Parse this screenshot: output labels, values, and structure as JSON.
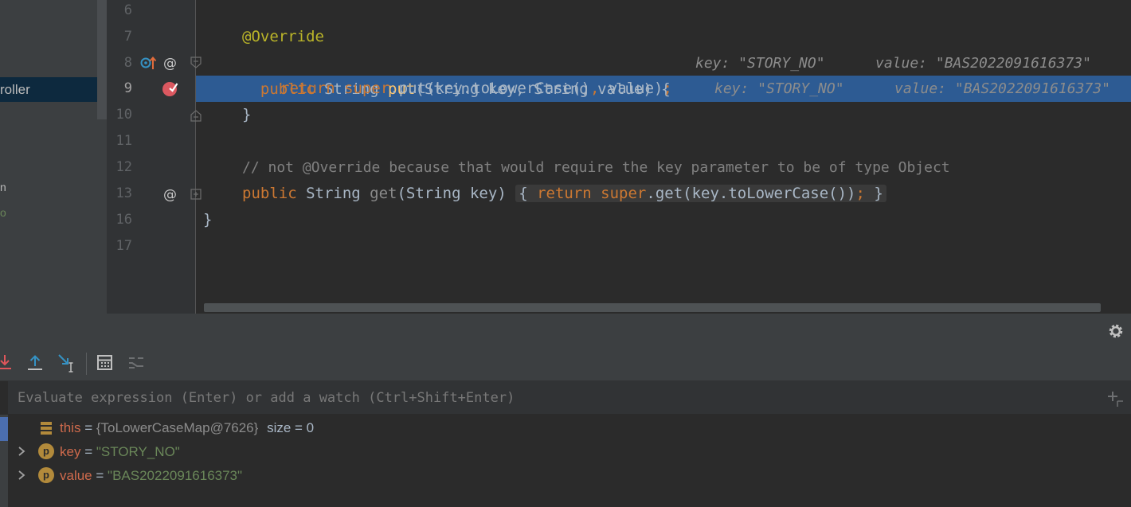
{
  "sidebar": {
    "selected_item": "roller",
    "fragments": [
      "n",
      "o"
    ]
  },
  "gutter": {
    "line_numbers": [
      "6",
      "7",
      "8",
      "9",
      "10",
      "11",
      "12",
      "13",
      "16",
      "17"
    ]
  },
  "code": {
    "line7": "@Override",
    "line8_code": "public String put(String key, String value) {",
    "line8_hint_key": "key: \"STORY_NO\"",
    "line8_hint_value": "value: \"BAS2022091616373\"",
    "line9_code": "return super.put(key.toLowerCase(), value);",
    "line9_hint_key": "key: \"STORY_NO\"",
    "line9_hint_value": "value: \"BAS2022091616373\"",
    "line10": "}",
    "line12": "// not @Override because that would require the key parameter to be of type Object",
    "line13_sig": "public String get(String key)",
    "line13_body": "return super.get(key.toLowerCase());",
    "line13_open": "{",
    "line13_close": "}",
    "line16": "}"
  },
  "watch": {
    "placeholder": "Evaluate expression (Enter) or add a watch (Ctrl+Shift+Enter)"
  },
  "variables": [
    {
      "name": "this",
      "eq": "=",
      "value": "{ToLowerCaseMap@7626}",
      "extra": "size = 0"
    },
    {
      "name": "key",
      "eq": "=",
      "value": "\"STORY_NO\""
    },
    {
      "name": "value",
      "eq": "=",
      "value": "\"BAS2022091616373\""
    }
  ],
  "colors": {
    "current_line": "#2d5b93",
    "keyword": "#cc7832",
    "annotation": "#bbb529",
    "method": "#ffc66d",
    "string": "#6a8759"
  }
}
